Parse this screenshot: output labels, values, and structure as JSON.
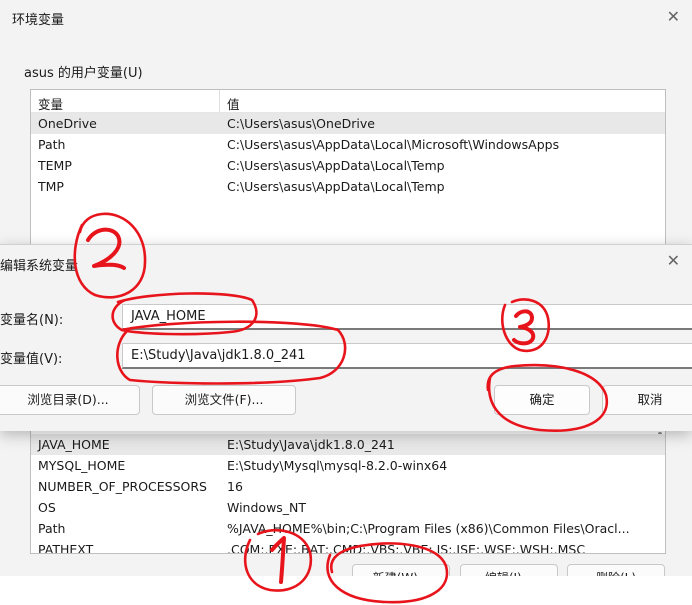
{
  "env_window": {
    "title": "环境变量",
    "close_icon": "close-icon",
    "user_group_label": "asus 的用户变量(U)",
    "columns": {
      "name": "变量",
      "value": "值"
    },
    "user_rows": [
      {
        "name": "OneDrive",
        "value": "C:\\Users\\asus\\OneDrive"
      },
      {
        "name": "Path",
        "value": "C:\\Users\\asus\\AppData\\Local\\Microsoft\\WindowsApps"
      },
      {
        "name": "TEMP",
        "value": "C:\\Users\\asus\\AppData\\Local\\Temp"
      },
      {
        "name": "TMP",
        "value": "C:\\Users\\asus\\AppData\\Local\\Temp"
      }
    ],
    "system_rows": [
      {
        "name": "JAVA_HOME",
        "value": "E:\\Study\\Java\\jdk1.8.0_241"
      },
      {
        "name": "MYSQL_HOME",
        "value": "E:\\Study\\Mysql\\mysql-8.2.0-winx64"
      },
      {
        "name": "NUMBER_OF_PROCESSORS",
        "value": "16"
      },
      {
        "name": "OS",
        "value": "Windows_NT"
      },
      {
        "name": "Path",
        "value": "%JAVA_HOME%\\bin;C:\\Program Files (x86)\\Common Files\\Oracl..."
      },
      {
        "name": "PATHEXT",
        "value": ".COM;.EXE;.BAT;.CMD;.VBS;.VBE;.JS;.JSE;.WSF;.WSH;.MSC"
      }
    ],
    "bottom_buttons": {
      "new": "新建(W)...",
      "edit": "编辑(I)...",
      "delete": "删除(L)"
    }
  },
  "edit_dialog": {
    "title": "编辑系统变量",
    "name_label": "变量名(N):",
    "name_value": "JAVA_HOME",
    "value_label": "变量值(V):",
    "value_value": "E:\\Study\\Java\\jdk1.8.0_241",
    "browse_dir": "浏览目录(D)...",
    "browse_file": "浏览文件(F)...",
    "ok": "确定",
    "cancel": "取消"
  },
  "annotations": {
    "color": "#e8141c",
    "step1": "1",
    "step2": "2",
    "step3": "3"
  }
}
